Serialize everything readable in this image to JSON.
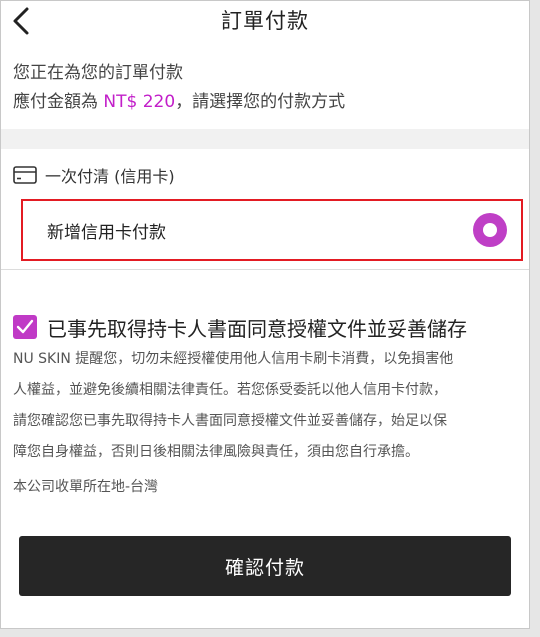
{
  "header": {
    "title": "訂單付款",
    "back_icon": "chevron-left-icon"
  },
  "intro": {
    "line1": "您正在為您的訂單付款",
    "amount_prefix": "應付金額為 ",
    "amount": "NT$ 220",
    "amount_suffix": "，請選擇您的付款方式"
  },
  "payment": {
    "method_label": "一次付清 (信用卡)",
    "method_icon": "credit-card-icon",
    "option_label": "新增信用卡付款",
    "option_selected": true
  },
  "consent": {
    "checked": true,
    "title": "已事先取得持卡人書面同意授權文件並妥善儲存",
    "notice_lines": [
      "NU SKIN 提醒您，切勿未經授權使用他人信用卡刷卡消費，以免損害他",
      "人權益，並避免後續相關法律責任。若您係受委託以他人信用卡付款，",
      "請您確認您已事先取得持卡人書面同意授權文件並妥善儲存，始足以保",
      "障您自身權益，否則日後相關法律風險與責任，須由您自行承擔。"
    ],
    "location": "本公司收單所在地-台灣"
  },
  "confirm_button": "確認付款",
  "colors": {
    "accent": "#c21fc9",
    "highlight_border": "#e31b23",
    "button_bg": "#262626"
  }
}
